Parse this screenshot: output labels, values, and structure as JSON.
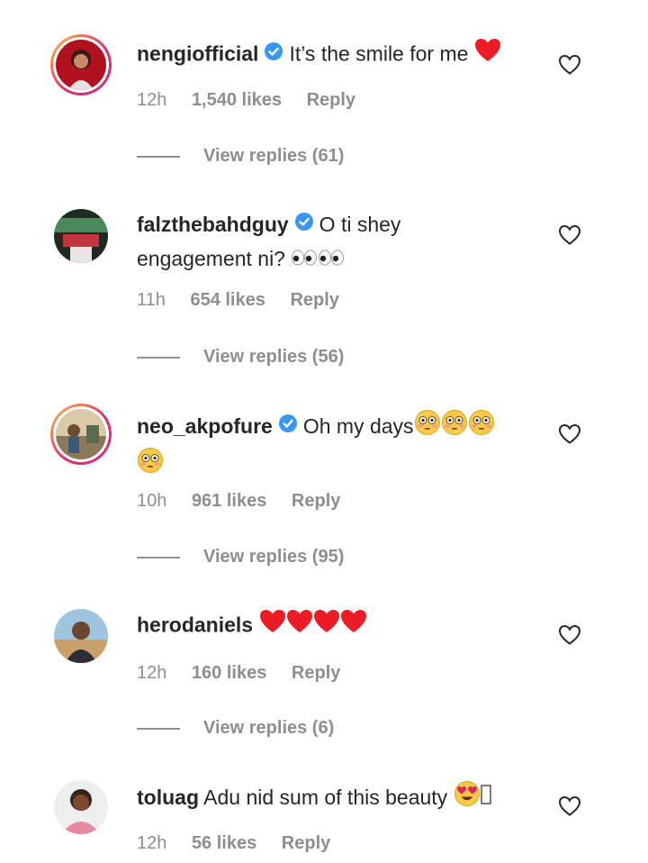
{
  "comments": [
    {
      "username": "nengiofficial",
      "text": "It’s the smile for me",
      "text_line2": "",
      "emojis": [
        "red-heart"
      ],
      "time": "12h",
      "likes": "1,540 likes",
      "reply": "Reply",
      "view_replies": "View replies (61)",
      "verified": true,
      "story_ring": true
    },
    {
      "username": "falzthebahdguy",
      "text": "O ti shey",
      "text_line2": "engagement ni?",
      "emojis": [
        "eyes",
        "eyes"
      ],
      "time": "11h",
      "likes": "654 likes",
      "reply": "Reply",
      "view_replies": "View replies (56)",
      "verified": true,
      "story_ring": false
    },
    {
      "username": "neo_akpofure",
      "text": "Oh my days",
      "text_line2": "",
      "emojis": [
        "flushed-face",
        "flushed-face",
        "flushed-face",
        "flushed-face"
      ],
      "time": "10h",
      "likes": "961 likes",
      "reply": "Reply",
      "view_replies": "View replies (95)",
      "verified": true,
      "story_ring": true
    },
    {
      "username": "herodaniels",
      "text": "",
      "text_line2": "",
      "emojis": [
        "red-heart",
        "red-heart",
        "red-heart",
        "red-heart"
      ],
      "time": "12h",
      "likes": "160 likes",
      "reply": "Reply",
      "view_replies": "View replies (6)",
      "verified": false,
      "story_ring": false
    },
    {
      "username": "toluag",
      "text": "Adu nid sum of this beauty",
      "text_line2": "",
      "emojis": [
        "heart-eyes-face",
        "missing-glyph"
      ],
      "time": "12h",
      "likes": "56 likes",
      "reply": "Reply",
      "view_replies": "",
      "verified": false,
      "story_ring": false
    }
  ],
  "colors": {
    "text": "#262626",
    "secondary": "#8e8e8e",
    "verified_blue": "#3897f0",
    "heart_red": "#ed1c24"
  }
}
